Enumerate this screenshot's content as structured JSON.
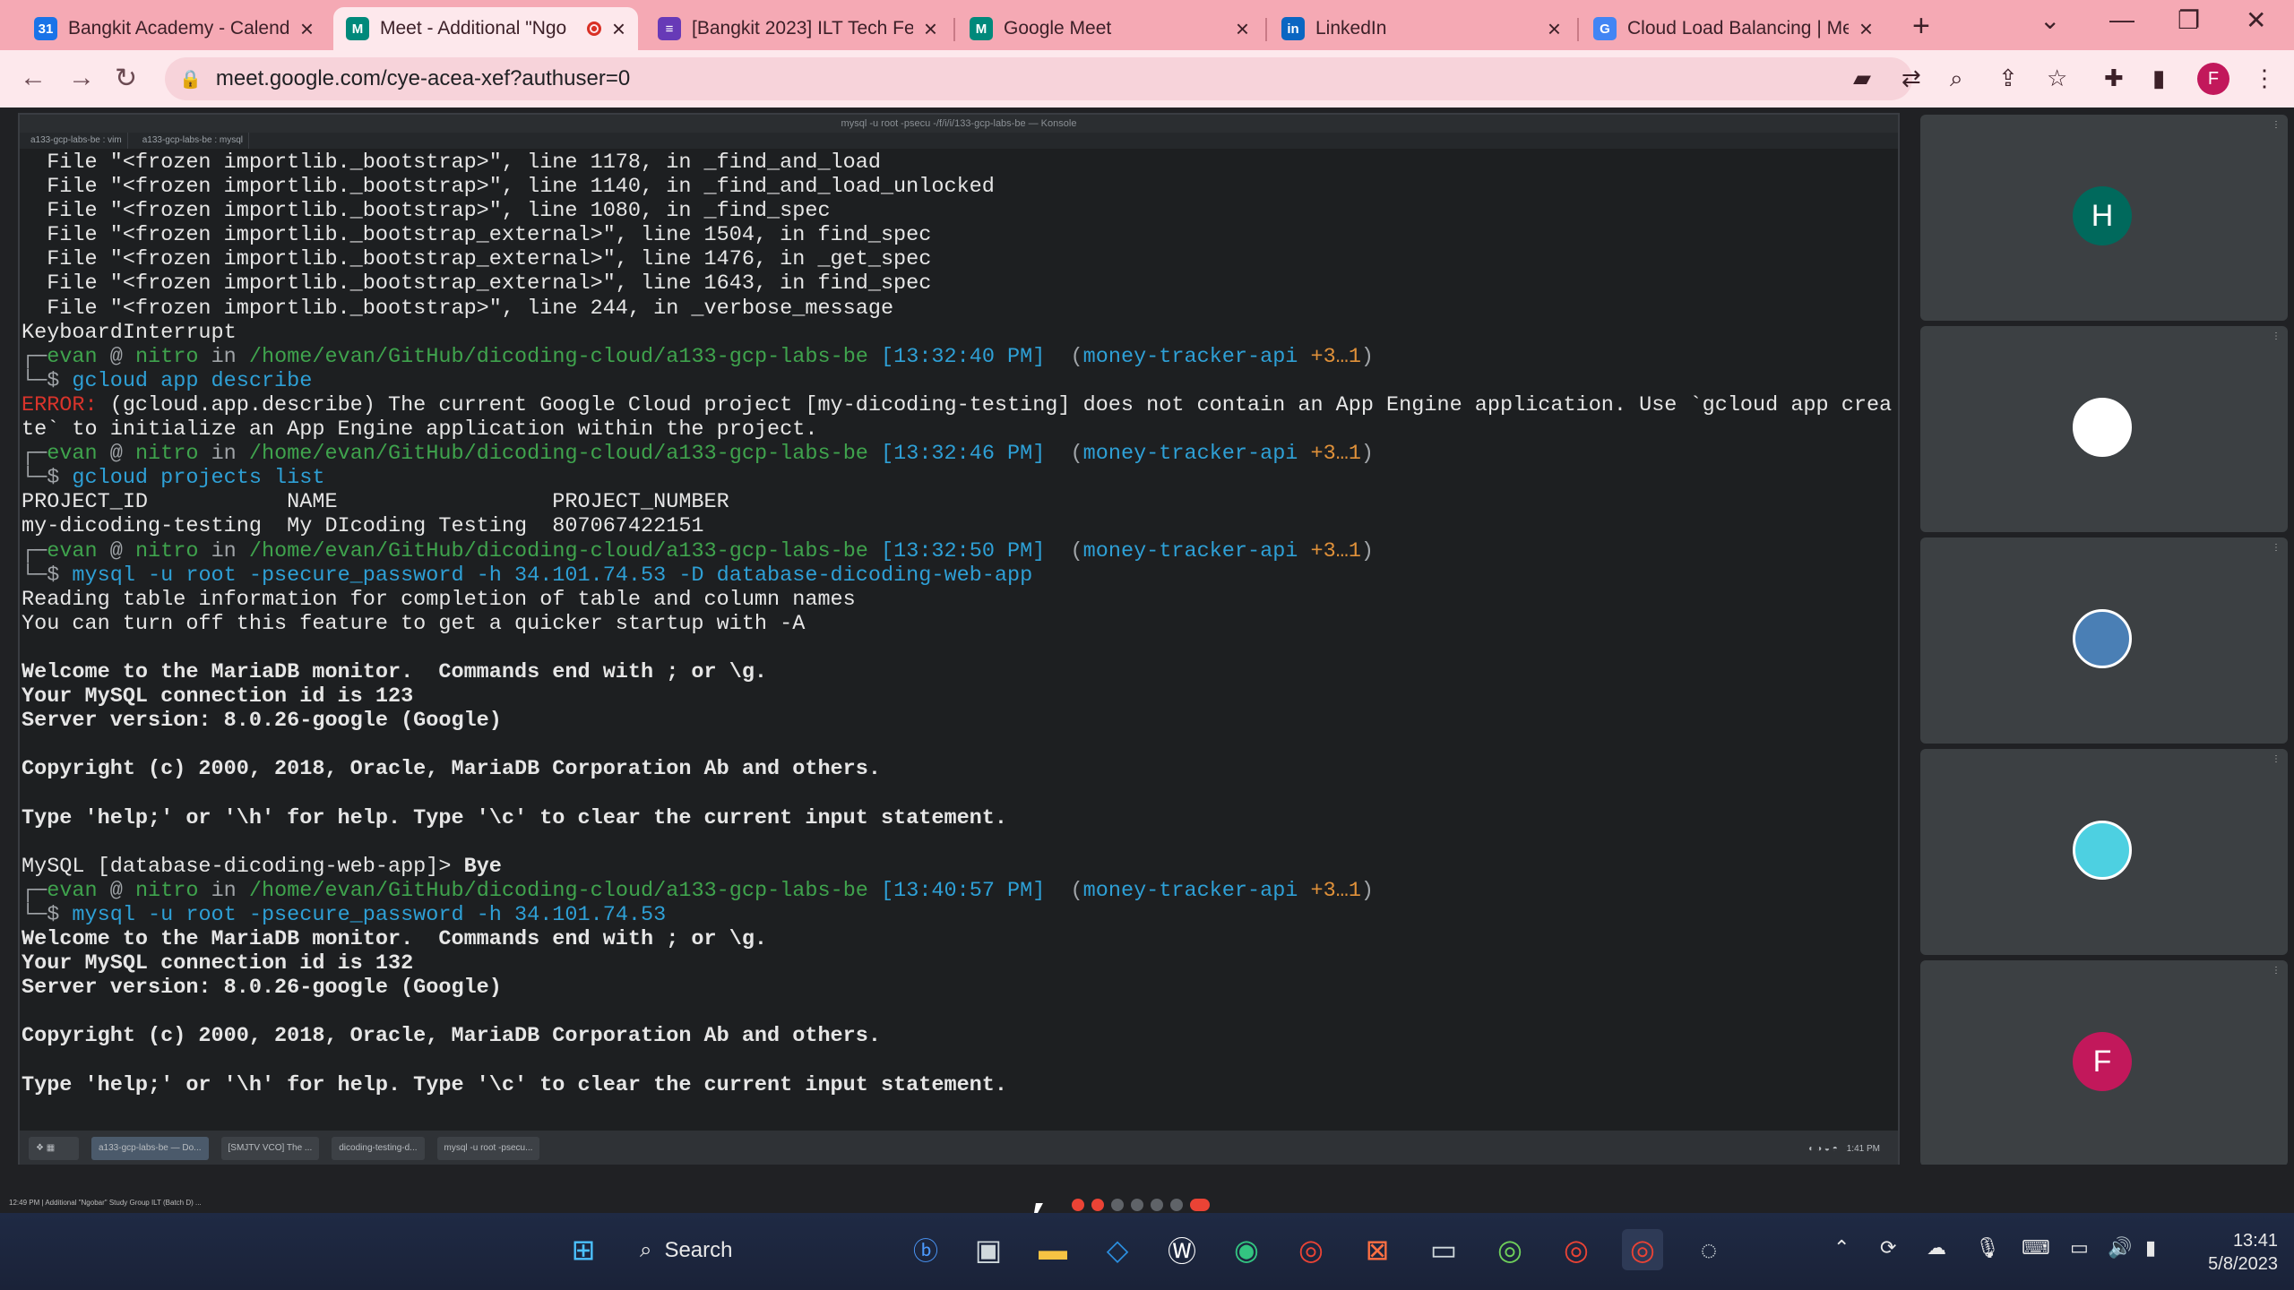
{
  "browser": {
    "tabs": [
      {
        "title": "Bangkit Academy - Calenda",
        "icon": "calendar-icon",
        "color": "#1a73e8",
        "glyph": "31"
      },
      {
        "title": "Meet - Additional \"Ngo",
        "icon": "meet-icon",
        "color": "#00897b",
        "glyph": "M",
        "active": true,
        "recording": true
      },
      {
        "title": "[Bangkit 2023] ILT Tech Fee",
        "icon": "forms-icon",
        "color": "#673ab7",
        "glyph": "≡"
      },
      {
        "title": "Google Meet",
        "icon": "meet-icon",
        "color": "#00897b",
        "glyph": "M"
      },
      {
        "title": "LinkedIn",
        "icon": "linkedin-icon",
        "color": "#0a66c2",
        "glyph": "in"
      },
      {
        "title": "Cloud Load Balancing | Me",
        "icon": "google-cloud-icon",
        "color": "#4285f4",
        "glyph": "G"
      }
    ],
    "url": "meet.google.com/cye-acea-xef?authuser=0",
    "profile_initial": "F"
  },
  "konsole": {
    "title": "mysql -u root -psecu -/f/i/i/133-gcp-labs-be — Konsole",
    "tabs": [
      "a133-gcp-labs-be : vim",
      "a133-gcp-labs-be : mysql"
    ]
  },
  "terminal": {
    "lines": [
      [
        {
          "t": "  File \"<frozen importlib._bootstrap>\", line 1178, in _find_and_load"
        }
      ],
      [
        {
          "t": "  File \"<frozen importlib._bootstrap>\", line 1140, in _find_and_load_unlocked"
        }
      ],
      [
        {
          "t": "  File \"<frozen importlib._bootstrap>\", line 1080, in _find_spec"
        }
      ],
      [
        {
          "t": "  File \"<frozen importlib._bootstrap_external>\", line 1504, in find_spec"
        }
      ],
      [
        {
          "t": "  File \"<frozen importlib._bootstrap_external>\", line 1476, in _get_spec"
        }
      ],
      [
        {
          "t": "  File \"<frozen importlib._bootstrap_external>\", line 1643, in find_spec"
        }
      ],
      [
        {
          "t": "  File \"<frozen importlib._bootstrap>\", line 244, in _verbose_message"
        }
      ],
      [
        {
          "t": "KeyboardInterrupt"
        }
      ],
      [
        {
          "t": "┌─",
          "c": "c-gray"
        },
        {
          "t": "evan",
          "c": "c-green"
        },
        {
          "t": " @ ",
          "c": "c-gray"
        },
        {
          "t": "nitro",
          "c": "c-green"
        },
        {
          "t": " in ",
          "c": "c-gray"
        },
        {
          "t": "/home/evan/GitHub/dicoding-cloud/a133-gcp-labs-be",
          "c": "c-green"
        },
        {
          "t": " [13:32:40 PM]",
          "c": "c-cyan"
        },
        {
          "t": "  (",
          "c": "c-gray"
        },
        {
          "t": "money-tracker-api",
          "c": "c-cyan"
        },
        {
          "t": " +3…1",
          "c": "c-orange"
        },
        {
          "t": ")",
          "c": "c-gray"
        }
      ],
      [
        {
          "t": "└─$ ",
          "c": "c-gray"
        },
        {
          "t": "gcloud app describe",
          "c": "c-blue"
        }
      ],
      [
        {
          "t": "ERROR:",
          "c": "c-red"
        },
        {
          "t": " (gcloud.app.describe) The current Google Cloud project [my-dicoding-testing] does not contain an App Engine application. Use `gcloud app crea"
        }
      ],
      [
        {
          "t": "te` to initialize an App Engine application within the project."
        }
      ],
      [
        {
          "t": "┌─",
          "c": "c-gray"
        },
        {
          "t": "evan",
          "c": "c-green"
        },
        {
          "t": " @ ",
          "c": "c-gray"
        },
        {
          "t": "nitro",
          "c": "c-green"
        },
        {
          "t": " in ",
          "c": "c-gray"
        },
        {
          "t": "/home/evan/GitHub/dicoding-cloud/a133-gcp-labs-be",
          "c": "c-green"
        },
        {
          "t": " [13:32:46 PM]",
          "c": "c-cyan"
        },
        {
          "t": "  (",
          "c": "c-gray"
        },
        {
          "t": "money-tracker-api",
          "c": "c-cyan"
        },
        {
          "t": " +3…1",
          "c": "c-orange"
        },
        {
          "t": ")",
          "c": "c-gray"
        }
      ],
      [
        {
          "t": "└─$ ",
          "c": "c-gray"
        },
        {
          "t": "gcloud projects list",
          "c": "c-blue"
        }
      ],
      [
        {
          "t": "PROJECT_ID           NAME                 PROJECT_NUMBER"
        }
      ],
      [
        {
          "t": "my-dicoding-testing  My DIcoding Testing  807067422151"
        }
      ],
      [
        {
          "t": "┌─",
          "c": "c-gray"
        },
        {
          "t": "evan",
          "c": "c-green"
        },
        {
          "t": " @ ",
          "c": "c-gray"
        },
        {
          "t": "nitro",
          "c": "c-green"
        },
        {
          "t": " in ",
          "c": "c-gray"
        },
        {
          "t": "/home/evan/GitHub/dicoding-cloud/a133-gcp-labs-be",
          "c": "c-green"
        },
        {
          "t": " [13:32:50 PM]",
          "c": "c-cyan"
        },
        {
          "t": "  (",
          "c": "c-gray"
        },
        {
          "t": "money-tracker-api",
          "c": "c-cyan"
        },
        {
          "t": " +3…1",
          "c": "c-orange"
        },
        {
          "t": ")",
          "c": "c-gray"
        }
      ],
      [
        {
          "t": "└─$ ",
          "c": "c-gray"
        },
        {
          "t": "mysql -u root -psecure_password -h 34.101.74.53 -D database-dicoding-web-app",
          "c": "c-blue"
        }
      ],
      [
        {
          "t": "Reading table information for completion of table and column names"
        }
      ],
      [
        {
          "t": "You can turn off this feature to get a quicker startup with -A"
        }
      ],
      [
        {
          "t": ""
        }
      ],
      [
        {
          "t": "Welcome to the MariaDB monitor.  Commands end with ; or \\g.",
          "c": "b"
        }
      ],
      [
        {
          "t": "Your MySQL connection id is 123",
          "c": "b"
        }
      ],
      [
        {
          "t": "Server version: 8.0.26-google (Google)",
          "c": "b"
        }
      ],
      [
        {
          "t": ""
        }
      ],
      [
        {
          "t": "Copyright (c) 2000, 2018, Oracle, MariaDB Corporation Ab and others.",
          "c": "b"
        }
      ],
      [
        {
          "t": ""
        }
      ],
      [
        {
          "t": "Type 'help;' or '\\h' for help. Type '\\c' to clear the current input statement.",
          "c": "b"
        }
      ],
      [
        {
          "t": ""
        }
      ],
      [
        {
          "t": "MySQL [database-dicoding-web-app]> "
        },
        {
          "t": "Bye",
          "c": "b"
        }
      ],
      [
        {
          "t": "┌─",
          "c": "c-gray"
        },
        {
          "t": "evan",
          "c": "c-green"
        },
        {
          "t": " @ ",
          "c": "c-gray"
        },
        {
          "t": "nitro",
          "c": "c-green"
        },
        {
          "t": " in ",
          "c": "c-gray"
        },
        {
          "t": "/home/evan/GitHub/dicoding-cloud/a133-gcp-labs-be",
          "c": "c-green"
        },
        {
          "t": " [13:40:57 PM]",
          "c": "c-cyan"
        },
        {
          "t": "  (",
          "c": "c-gray"
        },
        {
          "t": "money-tracker-api",
          "c": "c-cyan"
        },
        {
          "t": " +3…1",
          "c": "c-orange"
        },
        {
          "t": ")",
          "c": "c-gray"
        }
      ],
      [
        {
          "t": "└─$ ",
          "c": "c-gray"
        },
        {
          "t": "mysql -u root -psecure_password -h 34.101.74.53",
          "c": "c-blue"
        }
      ],
      [
        {
          "t": "Welcome to the MariaDB monitor.  Commands end with ; or \\g.",
          "c": "b"
        }
      ],
      [
        {
          "t": "Your MySQL connection id is 132",
          "c": "b"
        }
      ],
      [
        {
          "t": "Server version: 8.0.26-google (Google)",
          "c": "b"
        }
      ],
      [
        {
          "t": ""
        }
      ],
      [
        {
          "t": "Copyright (c) 2000, 2018, Oracle, MariaDB Corporation Ab and others.",
          "c": "b"
        }
      ],
      [
        {
          "t": ""
        }
      ],
      [
        {
          "t": "Type 'help;' or '\\h' for help. Type '\\c' to clear the current input statement.",
          "c": "b"
        }
      ]
    ]
  },
  "inner_taskbar": {
    "tasks": [
      "a133-gcp-labs-be — Do...",
      "[SMJTV VCO] The ...",
      "dicoding-testing-d...",
      "mysql -u root -psecu..."
    ],
    "tray": "1:41 PM"
  },
  "participants": [
    {
      "initial": "H",
      "color": "#00695c"
    },
    {
      "initial": "",
      "color": "#ffffff",
      "photo": true
    },
    {
      "initial": "",
      "color": "#4a7fb5",
      "photo": true
    },
    {
      "initial": "",
      "color": "#4dd0e1",
      "photo": true
    },
    {
      "initial": "F",
      "color": "#c2185b"
    }
  ],
  "meet": {
    "meeting_title": "12:49 PM | Additional \"Ngobar\" Study Group ILT (Batch D) ..."
  },
  "windows": {
    "search_label": "Search",
    "time": "13:41",
    "date": "5/8/2023"
  }
}
